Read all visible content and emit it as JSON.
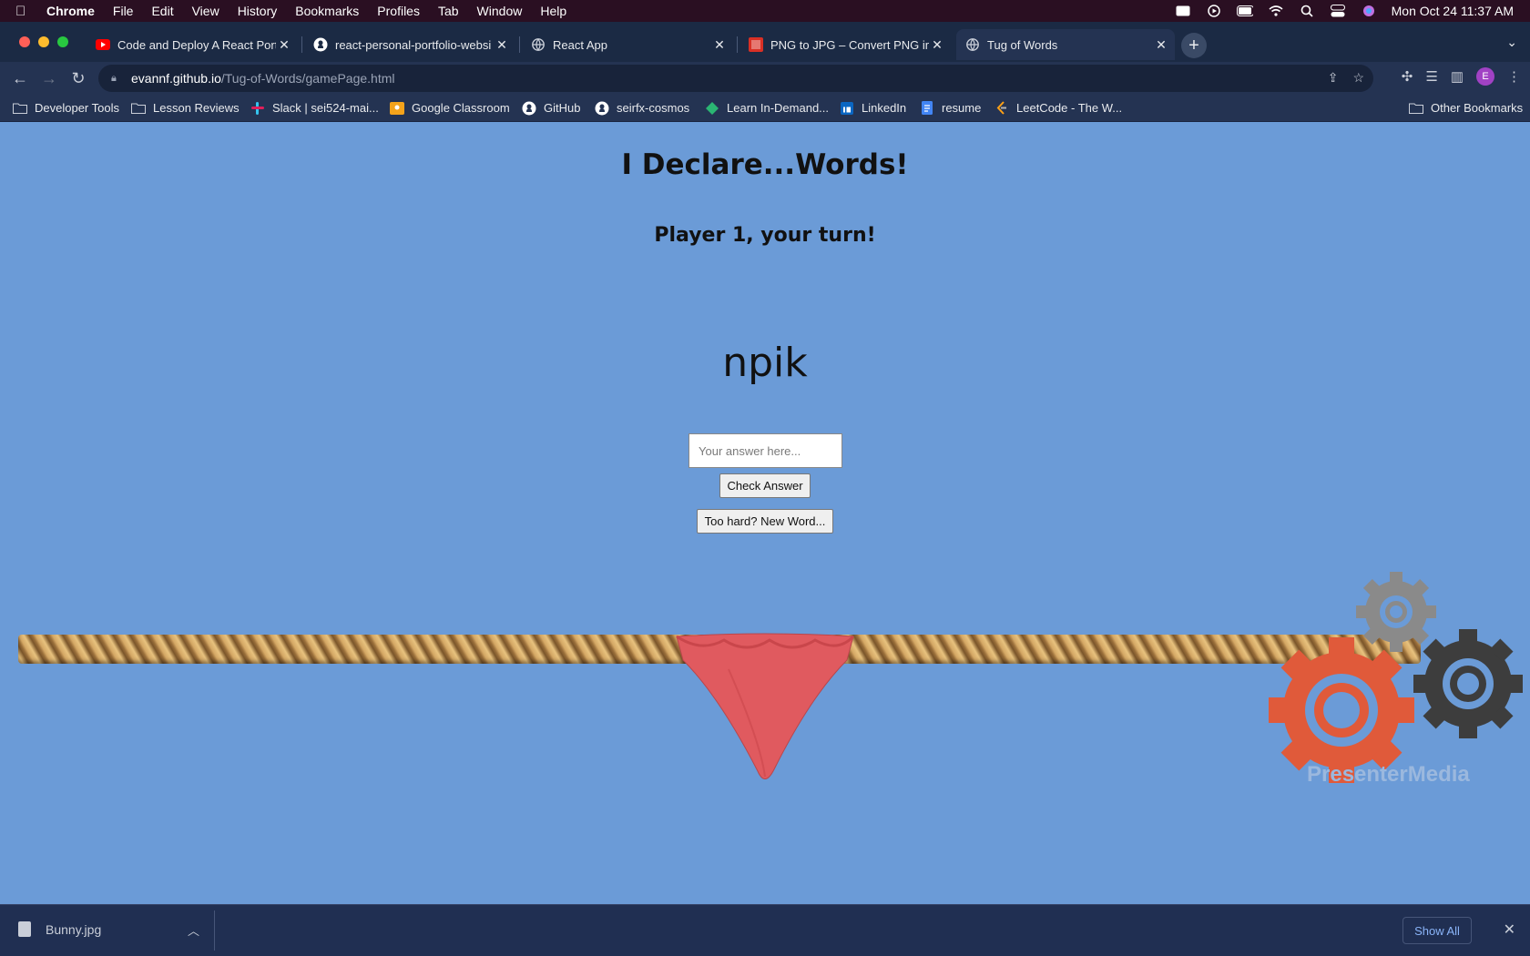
{
  "menubar": {
    "app": "Chrome",
    "items": [
      "File",
      "Edit",
      "View",
      "History",
      "Bookmarks",
      "Profiles",
      "Tab",
      "Window",
      "Help"
    ],
    "clock": "Mon Oct 24  11:37 AM"
  },
  "tabs": [
    {
      "title": "Code and Deploy A React Portf",
      "icon": "youtube-icon"
    },
    {
      "title": "react-personal-portfolio-websi",
      "icon": "github-icon"
    },
    {
      "title": "React App",
      "icon": "globe-icon"
    },
    {
      "title": "PNG to JPG – Convert PNG ima",
      "icon": "png-jpg-icon"
    },
    {
      "title": "Tug of Words",
      "icon": "globe-icon",
      "active": true
    }
  ],
  "address": {
    "domain": "evannf.github.io",
    "path": "/Tug-of-Words/gamePage.html"
  },
  "profile_initial": "E",
  "bookmarks": [
    {
      "label": "Developer Tools",
      "icon": "folder-icon"
    },
    {
      "label": "Lesson Reviews",
      "icon": "folder-icon"
    },
    {
      "label": "Slack | sei524-mai...",
      "icon": "slack-icon"
    },
    {
      "label": "Google Classroom",
      "icon": "classroom-icon"
    },
    {
      "label": "GitHub",
      "icon": "github-icon"
    },
    {
      "label": "seirfx-cosmos",
      "icon": "github-icon"
    },
    {
      "label": "Learn In-Demand...",
      "icon": "learn-icon"
    },
    {
      "label": "LinkedIn",
      "icon": "linkedin-icon"
    },
    {
      "label": "resume",
      "icon": "docs-icon"
    },
    {
      "label": "LeetCode - The W...",
      "icon": "leetcode-icon"
    }
  ],
  "other_bookmarks": "Other Bookmarks",
  "game": {
    "title": "I Declare...Words!",
    "turn": "Player 1, your turn!",
    "scrambled_word": "npik",
    "answer_placeholder": "Your answer here...",
    "check_button": "Check Answer",
    "new_word_button": "Too hard? New Word...",
    "watermark": "PresenterMedia"
  },
  "colors": {
    "page_bg": "#6b9bd7",
    "flag": "#e05a5f",
    "gear_orange": "#e05a3a",
    "gear_dark": "#3d3d3d",
    "gear_gray": "#8a8a8a"
  },
  "downloads": {
    "file": "Bunny.jpg",
    "show_all": "Show All"
  }
}
